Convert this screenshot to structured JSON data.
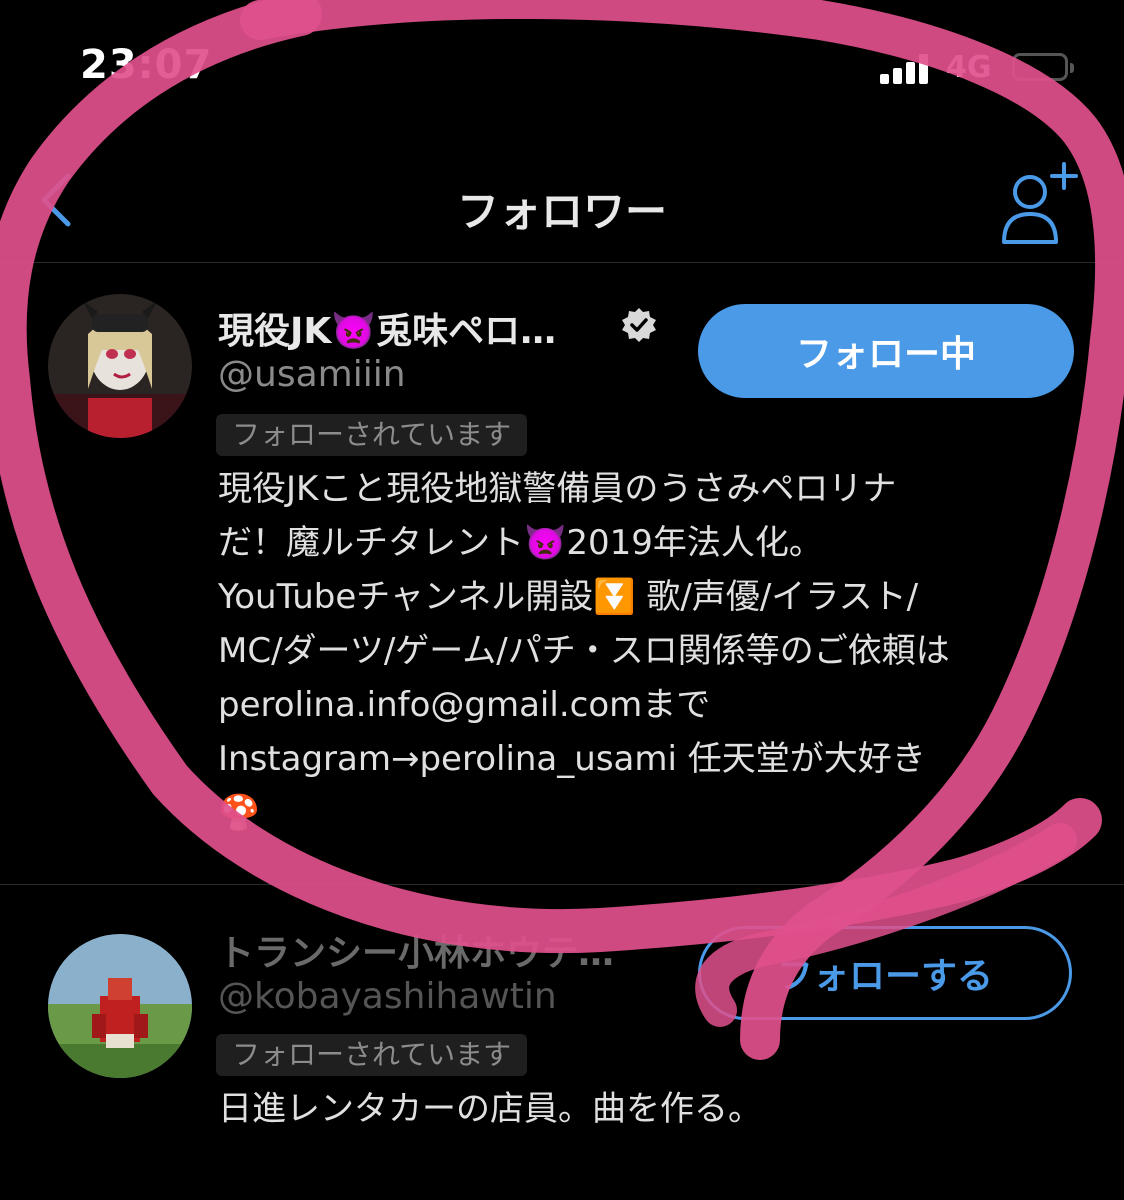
{
  "status_bar": {
    "time": "23:07",
    "network": "4G"
  },
  "nav": {
    "title": "フォロワー",
    "back_icon": "chevron-left-icon",
    "add_icon": "add-user-icon"
  },
  "followers": [
    {
      "display_name": "現役JK👿兎味ペロ…",
      "handle": "@usamiiin",
      "follows_you": "フォローされています",
      "button_label": "フォロー中",
      "verified": true,
      "bio": "現役JKこと現役地獄警備員のうさみペロリナ\nだ！魔ルチタレント👿2019年法人化。\nYouTubeチャンネル開設⏬ 歌/声優/イラスト/\nMC/ダーツ/ゲーム/パチ・スロ関係等のご依頼は\nperolina.info@gmail.comまで\nInstagram→perolina_usami 任天堂が大好き\n🍄"
    },
    {
      "display_name": "トランシー小林ホウテ…",
      "handle": "@kobayashihawtin",
      "follows_you": "フォローされています",
      "button_label": "フォローする",
      "verified": false,
      "bio": "日進レンタカーの店員。曲を作る。"
    }
  ],
  "colors": {
    "accent": "#4a9ae8",
    "highlight": "#e0508c",
    "background": "#000000"
  }
}
